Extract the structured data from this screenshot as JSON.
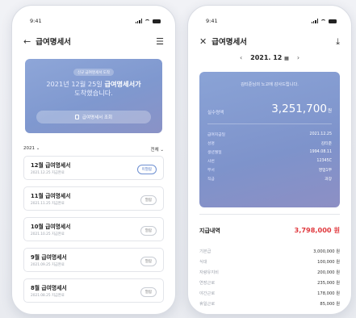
{
  "left": {
    "status_time": "9:41",
    "title": "급여명세서",
    "hero": {
      "badge": "신규 급여명세서 도착",
      "message_prefix": "2021년 12월 25일",
      "message_bold": "급여명세서가",
      "message_line2": "도착했습니다.",
      "button_label": "급여명세서 조회"
    },
    "filter": {
      "year": "2021",
      "scope": "전체"
    },
    "items": [
      {
        "title": "12월 급여명세서",
        "date": "2021.12.25 지급완료",
        "status": "미열람",
        "unread": true
      },
      {
        "title": "11월 급여명세서",
        "date": "2021.11.25 지급완료",
        "status": "열람",
        "unread": false
      },
      {
        "title": "10월 급여명세서",
        "date": "2021.10.25 지급완료",
        "status": "열람",
        "unread": false
      },
      {
        "title": "9월 급여명세서",
        "date": "2021.09.25 지급완료",
        "status": "열람",
        "unread": false
      },
      {
        "title": "8월 급여명세서",
        "date": "2021.08.25 지급완료",
        "status": "열람",
        "unread": false
      }
    ]
  },
  "right": {
    "status_time": "9:41",
    "title": "급여명세서",
    "month": "2021. 12",
    "card": {
      "greeting": "김티준님의 노고에 감사드립니다.",
      "net_label": "실수령액",
      "net_value": "3,251,700",
      "net_unit": "원",
      "info": [
        {
          "k": "급여지급일",
          "v": "2021.12.25"
        },
        {
          "k": "성명",
          "v": "김티준"
        },
        {
          "k": "생년월일",
          "v": "1994.08.11"
        },
        {
          "k": "사번",
          "v": "12345C"
        },
        {
          "k": "부서",
          "v": "영업1부"
        },
        {
          "k": "직급",
          "v": "과장"
        }
      ]
    },
    "pay": {
      "label": "지급내역",
      "total": "3,798,000 원",
      "rows": [
        {
          "k": "기본급",
          "v": "3,000,000 원"
        },
        {
          "k": "식대",
          "v": "100,000 원"
        },
        {
          "k": "자량유지비",
          "v": "200,000 원"
        },
        {
          "k": "연장근로",
          "v": "235,000 원"
        },
        {
          "k": "야간근로",
          "v": "178,000 원"
        },
        {
          "k": "휴일근로",
          "v": "85,000 원"
        }
      ]
    }
  },
  "colors": {
    "accent_blue": "#7f98cf",
    "total_red": "#e0393e"
  }
}
